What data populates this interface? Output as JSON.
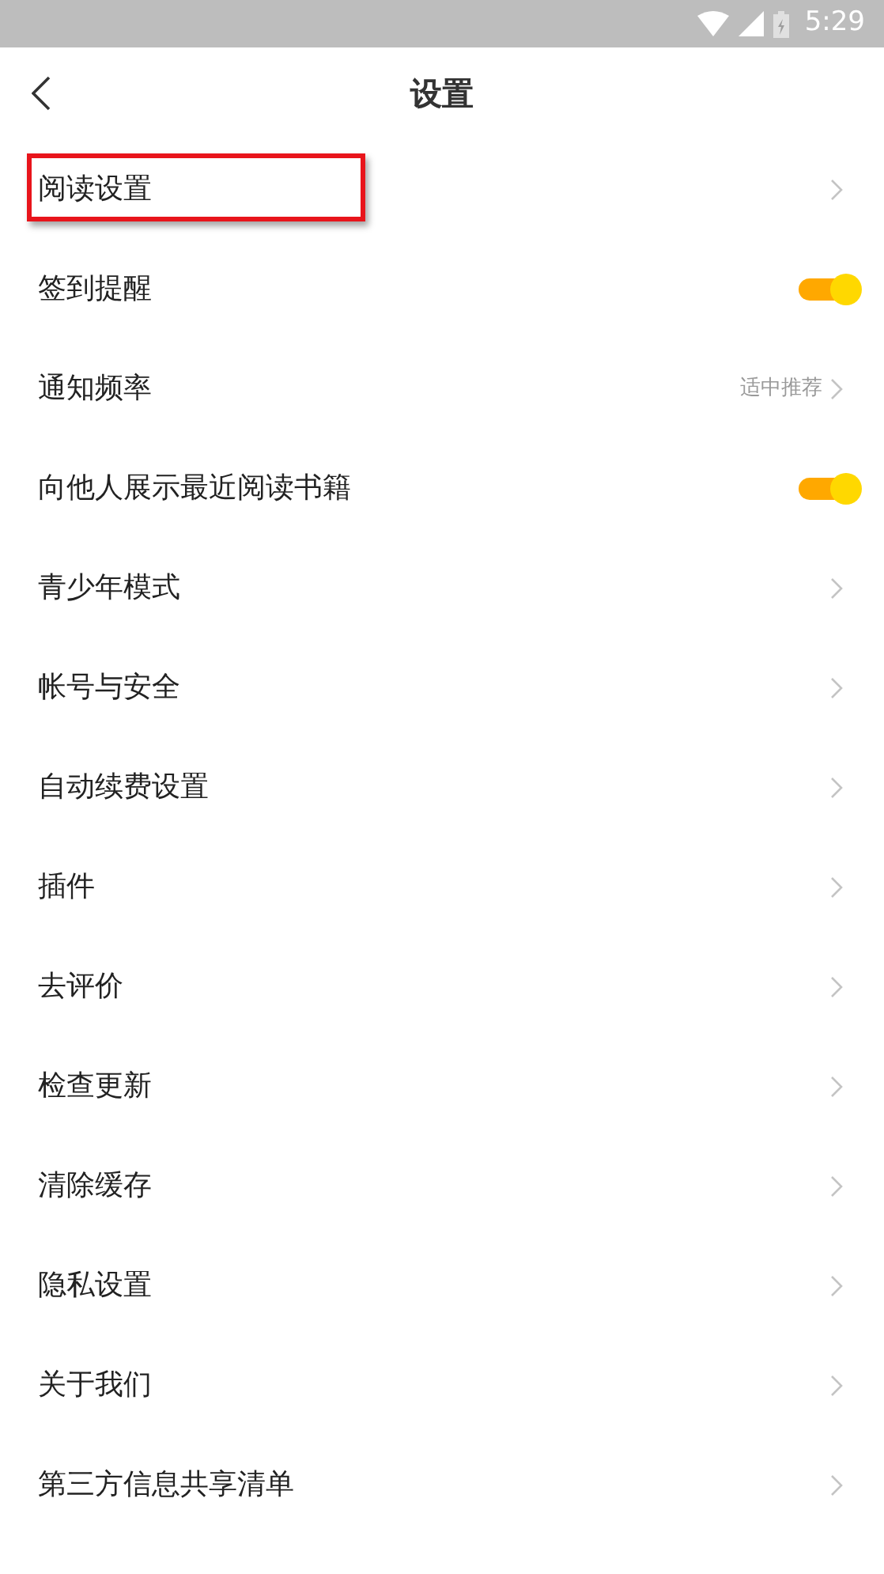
{
  "status_bar": {
    "time": "5:29"
  },
  "header": {
    "title": "设置"
  },
  "items": [
    {
      "kind": "link",
      "label": "阅读设置",
      "highlighted": true
    },
    {
      "kind": "toggle",
      "label": "签到提醒",
      "on": true,
      "highlighted": false
    },
    {
      "kind": "link",
      "label": "通知频率",
      "value": "适中推荐",
      "highlighted": false
    },
    {
      "kind": "toggle",
      "label": "向他人展示最近阅读书籍",
      "on": true,
      "highlighted": false
    },
    {
      "kind": "link",
      "label": "青少年模式",
      "highlighted": false
    },
    {
      "kind": "link",
      "label": "帐号与安全",
      "highlighted": false
    },
    {
      "kind": "link",
      "label": "自动续费设置",
      "highlighted": false
    },
    {
      "kind": "link",
      "label": "插件",
      "highlighted": false
    },
    {
      "kind": "link",
      "label": "去评价",
      "highlighted": false
    },
    {
      "kind": "link",
      "label": "检查更新",
      "highlighted": false
    },
    {
      "kind": "link",
      "label": "清除缓存",
      "highlighted": false
    },
    {
      "kind": "link",
      "label": "隐私设置",
      "highlighted": false
    },
    {
      "kind": "link",
      "label": "关于我们",
      "highlighted": false
    },
    {
      "kind": "link",
      "label": "第三方信息共享清单",
      "highlighted": false
    }
  ]
}
